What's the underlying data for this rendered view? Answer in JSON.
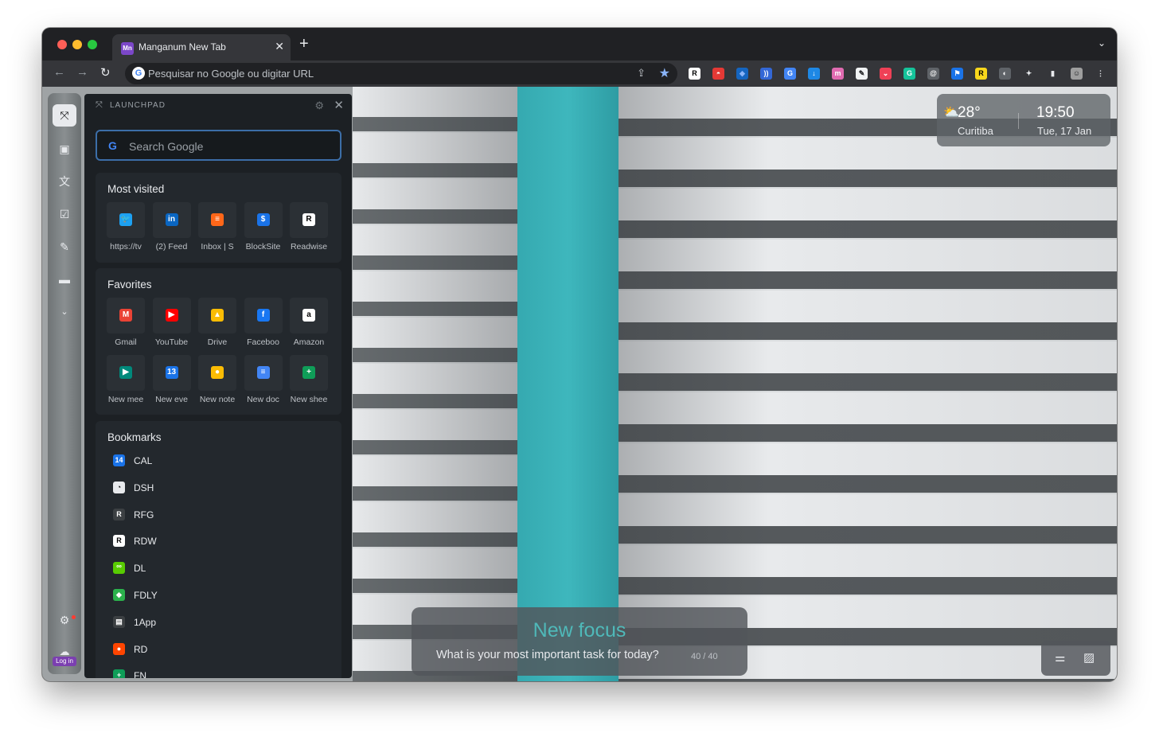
{
  "browser": {
    "tab_title": "Manganum New Tab",
    "tab_favicon": "Mn",
    "new_tab_symbol": "+",
    "omnibox_placeholder": "Pesquisar no Google ou digitar URL",
    "extensions": [
      {
        "name": "readwise-ext-icon",
        "glyph": "R",
        "color": "#ffffff",
        "fg": "#000000"
      },
      {
        "name": "pokeball-ext-icon",
        "glyph": "◓",
        "color": "#e53935",
        "fg": "#ffffff"
      },
      {
        "name": "gem-ext-icon",
        "glyph": "◆",
        "color": "#1565c0",
        "fg": "#8ab4f8"
      },
      {
        "name": "wave-ext-icon",
        "glyph": "))",
        "color": "#3367d6",
        "fg": "#ffffff"
      },
      {
        "name": "translate-ext-icon",
        "glyph": "G",
        "color": "#4285f4",
        "fg": "#ffffff"
      },
      {
        "name": "download-ext-icon",
        "glyph": "↓",
        "color": "#1e88e5",
        "fg": "#ffffff"
      },
      {
        "name": "m-ext-icon",
        "glyph": "m",
        "color": "#e06bb1",
        "fg": "#ffffff"
      },
      {
        "name": "note-ext-icon",
        "glyph": "✎",
        "color": "#f1f3f4",
        "fg": "#202124"
      },
      {
        "name": "pocket-ext-icon",
        "glyph": "⌄",
        "color": "#ef4056",
        "fg": "#ffffff"
      },
      {
        "name": "grammarly-ext-icon",
        "glyph": "G",
        "color": "#15c39a",
        "fg": "#ffffff"
      },
      {
        "name": "circle-ext-icon",
        "glyph": "@",
        "color": "#5f6368",
        "fg": "#ffffff"
      },
      {
        "name": "flag-ext-icon",
        "glyph": "⚑",
        "color": "#1a73e8",
        "fg": "#ffffff"
      },
      {
        "name": "r-yellow-ext-icon",
        "glyph": "R",
        "color": "#f9d71c",
        "fg": "#000000"
      },
      {
        "name": "badge-ext-icon",
        "glyph": "◐",
        "color": "#5f6368",
        "fg": "#ffffff"
      },
      {
        "name": "puzzle-ext-icon",
        "glyph": "✦",
        "color": "#35363a",
        "fg": "#e8eaed"
      },
      {
        "name": "sidepanel-ext-icon",
        "glyph": "▮",
        "color": "#35363a",
        "fg": "#e8eaed"
      },
      {
        "name": "profile-avatar-icon",
        "glyph": "☺",
        "color": "#9e9e9e",
        "fg": "#202124"
      },
      {
        "name": "menu-dots-icon",
        "glyph": "⋮",
        "color": "#35363a",
        "fg": "#e8eaed"
      }
    ]
  },
  "launchpad": {
    "title": "LAUNCHPAD",
    "search_placeholder": "Search Google",
    "most_visited_title": "Most visited",
    "most_visited": [
      {
        "label": "https://tv",
        "glyph": "🐦",
        "color": "#1da1f2",
        "icon": "twitter-icon"
      },
      {
        "label": "(2) Feed",
        "glyph": "in",
        "color": "#0a66c2",
        "icon": "linkedin-icon"
      },
      {
        "label": "Inbox | S",
        "glyph": "≡",
        "color": "#ff6719",
        "icon": "substack-icon"
      },
      {
        "label": "BlockSite",
        "glyph": "$",
        "color": "#1a73e8",
        "icon": "blocksite-icon"
      },
      {
        "label": "Readwise",
        "glyph": "R",
        "color": "#ffffff",
        "icon": "readwise-icon"
      }
    ],
    "favorites_title": "Favorites",
    "favorites": [
      {
        "label": "Gmail",
        "glyph": "M",
        "color": "#ea4335",
        "icon": "gmail-icon"
      },
      {
        "label": "YouTube",
        "glyph": "▶",
        "color": "#ff0000",
        "icon": "youtube-icon"
      },
      {
        "label": "Drive",
        "glyph": "▲",
        "color": "#fbbc04",
        "icon": "drive-icon"
      },
      {
        "label": "Faceboo",
        "glyph": "f",
        "color": "#1877f2",
        "icon": "facebook-icon"
      },
      {
        "label": "Amazon",
        "glyph": "a",
        "color": "#ffffff",
        "icon": "amazon-icon"
      },
      {
        "label": "New mee",
        "glyph": "▶",
        "color": "#00897b",
        "icon": "meet-icon"
      },
      {
        "label": "New eve",
        "glyph": "13",
        "color": "#1a73e8",
        "icon": "calendar-icon"
      },
      {
        "label": "New note",
        "glyph": "●",
        "color": "#fbbc04",
        "icon": "keep-icon"
      },
      {
        "label": "New doc",
        "glyph": "≡",
        "color": "#4285f4",
        "icon": "docs-icon"
      },
      {
        "label": "New shee",
        "glyph": "+",
        "color": "#0f9d58",
        "icon": "sheets-icon"
      }
    ],
    "bookmarks_title": "Bookmarks",
    "bookmarks": [
      {
        "label": "CAL",
        "glyph": "14",
        "color": "#1a73e8",
        "icon": "calendar-icon"
      },
      {
        "label": "DSH",
        "glyph": "◔",
        "color": "#e8eaed",
        "icon": "compass-icon"
      },
      {
        "label": "RFG",
        "glyph": "R",
        "color": "#3c4043",
        "icon": "readwise-outline-icon"
      },
      {
        "label": "RDW",
        "glyph": "R",
        "color": "#ffffff",
        "icon": "readwise-icon"
      },
      {
        "label": "DL",
        "glyph": "ºº",
        "color": "#58cc02",
        "icon": "duolingo-icon"
      },
      {
        "label": "FDLY",
        "glyph": "◆",
        "color": "#2bb24c",
        "icon": "feedly-icon"
      },
      {
        "label": "1App",
        "glyph": "▤",
        "color": "#3c4043",
        "icon": "news-icon"
      },
      {
        "label": "RD",
        "glyph": "●",
        "color": "#ff4500",
        "icon": "reddit-icon"
      },
      {
        "label": "FN",
        "glyph": "+",
        "color": "#0f9d58",
        "icon": "sheets-icon"
      }
    ]
  },
  "dock": {
    "login_label": "Log in"
  },
  "weather": {
    "temperature": "28°",
    "city": "Curitiba",
    "time": "19:50",
    "date": "Tue, 17 Jan"
  },
  "focus": {
    "title": "New focus",
    "question": "What is your most important task for today?",
    "counter": "40 / 40"
  }
}
